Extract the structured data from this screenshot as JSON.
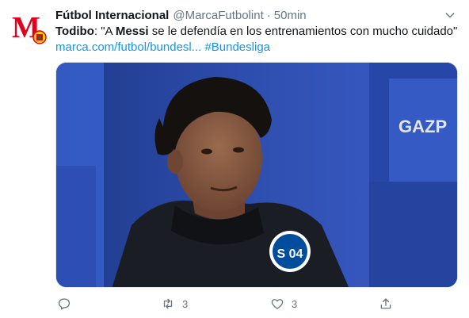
{
  "tweet": {
    "display_name": "Fútbol Internacional",
    "handle": "@MarcaFutbolint",
    "separator": "·",
    "timestamp": "50min",
    "text_prefix": "Todibo",
    "text_part1": ": \"A ",
    "text_bold": "Messi",
    "text_part2": " se le defendía en los entrenamientos con mucho cuidado\"",
    "link_url": "marca.com/futbol/bundesl...",
    "hashtag": "#Bundesliga",
    "media_badge_text": "S 04",
    "sponsor_text": "GAZP"
  },
  "actions": {
    "reply_count": "",
    "retweet_count": "3",
    "like_count": "3"
  },
  "avatar": {
    "letter": "M"
  },
  "colors": {
    "accent": "#1b95e0",
    "muted": "#657786",
    "brand_red": "#e2001a",
    "schalke_blue": "#004d9d"
  },
  "icons": {
    "caret": "chevron-down-icon",
    "reply": "reply-icon",
    "retweet": "retweet-icon",
    "like": "heart-icon",
    "share": "share-icon"
  }
}
